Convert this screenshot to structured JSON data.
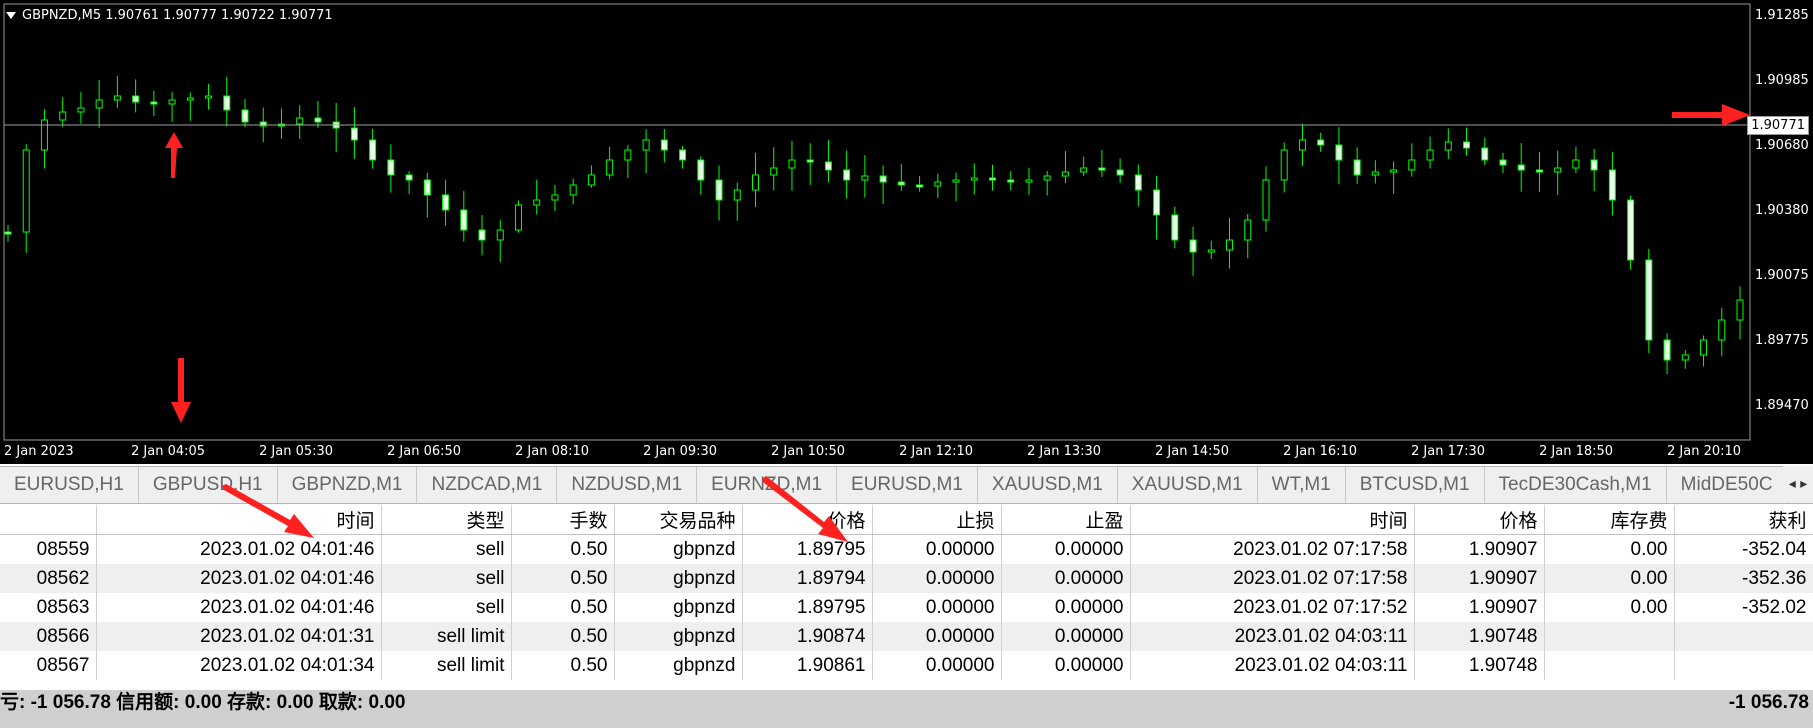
{
  "chart": {
    "symbol_header": "GBPNZD,M5  1.90761 1.90777 1.90722 1.90771",
    "current_price": "1.90771",
    "price_labels": [
      "1.91285",
      "1.90985",
      "1.90680",
      "1.90380",
      "1.90075",
      "1.89775",
      "1.89470"
    ],
    "time_labels": [
      "2 Jan 2023",
      "2 Jan 04:05",
      "2 Jan 05:30",
      "2 Jan 06:50",
      "2 Jan 08:10",
      "2 Jan 09:30",
      "2 Jan 10:50",
      "2 Jan 12:10",
      "2 Jan 13:30",
      "2 Jan 14:50",
      "2 Jan 16:10",
      "2 Jan 17:30",
      "2 Jan 18:50",
      "2 Jan 20:10"
    ],
    "colors": {
      "background": "#000000",
      "candle": "#00ff00",
      "axis_text": "#ffffff",
      "annotation_arrow": "#ff2020"
    }
  },
  "tabs": [
    "EURUSD,H1",
    "GBPUSD,H1",
    "GBPNZD,M1",
    "NZDCAD,M1",
    "NZDUSD,M1",
    "EURNZD,M1",
    "EURUSD,M1",
    "XAUUSD,M1",
    "XAUUSD,M1",
    "WT,M1",
    "BTCUSD,M1",
    "TecDE30Cash,M1",
    "MidDE50C"
  ],
  "tab_scroll": "◂ ▸",
  "table": {
    "headers": [
      "",
      "时间",
      "类型",
      "手数",
      "交易品种",
      "价格",
      "止损",
      "止盈",
      "时间",
      "价格",
      "库存费",
      "获利"
    ],
    "rows": [
      [
        "08559",
        "2023.01.02 04:01:46",
        "sell",
        "0.50",
        "gbpnzd",
        "1.89795",
        "0.00000",
        "0.00000",
        "2023.01.02 07:17:58",
        "1.90907",
        "0.00",
        "-352.04"
      ],
      [
        "08562",
        "2023.01.02 04:01:46",
        "sell",
        "0.50",
        "gbpnzd",
        "1.89794",
        "0.00000",
        "0.00000",
        "2023.01.02 07:17:58",
        "1.90907",
        "0.00",
        "-352.36"
      ],
      [
        "08563",
        "2023.01.02 04:01:46",
        "sell",
        "0.50",
        "gbpnzd",
        "1.89795",
        "0.00000",
        "0.00000",
        "2023.01.02 07:17:52",
        "1.90907",
        "0.00",
        "-352.02"
      ],
      [
        "08566",
        "2023.01.02 04:01:31",
        "sell limit",
        "0.50",
        "gbpnzd",
        "1.90874",
        "0.00000",
        "0.00000",
        "2023.01.02 04:03:11",
        "1.90748",
        "",
        ""
      ],
      [
        "08567",
        "2023.01.02 04:01:34",
        "sell limit",
        "0.50",
        "gbpnzd",
        "1.90861",
        "0.00000",
        "0.00000",
        "2023.01.02 04:03:11",
        "1.90748",
        "",
        ""
      ]
    ]
  },
  "summary": {
    "left": "亏: -1 056.78  信用额: 0.00  存款: 0.00  取款: 0.00",
    "right": "-1 056.78"
  }
}
